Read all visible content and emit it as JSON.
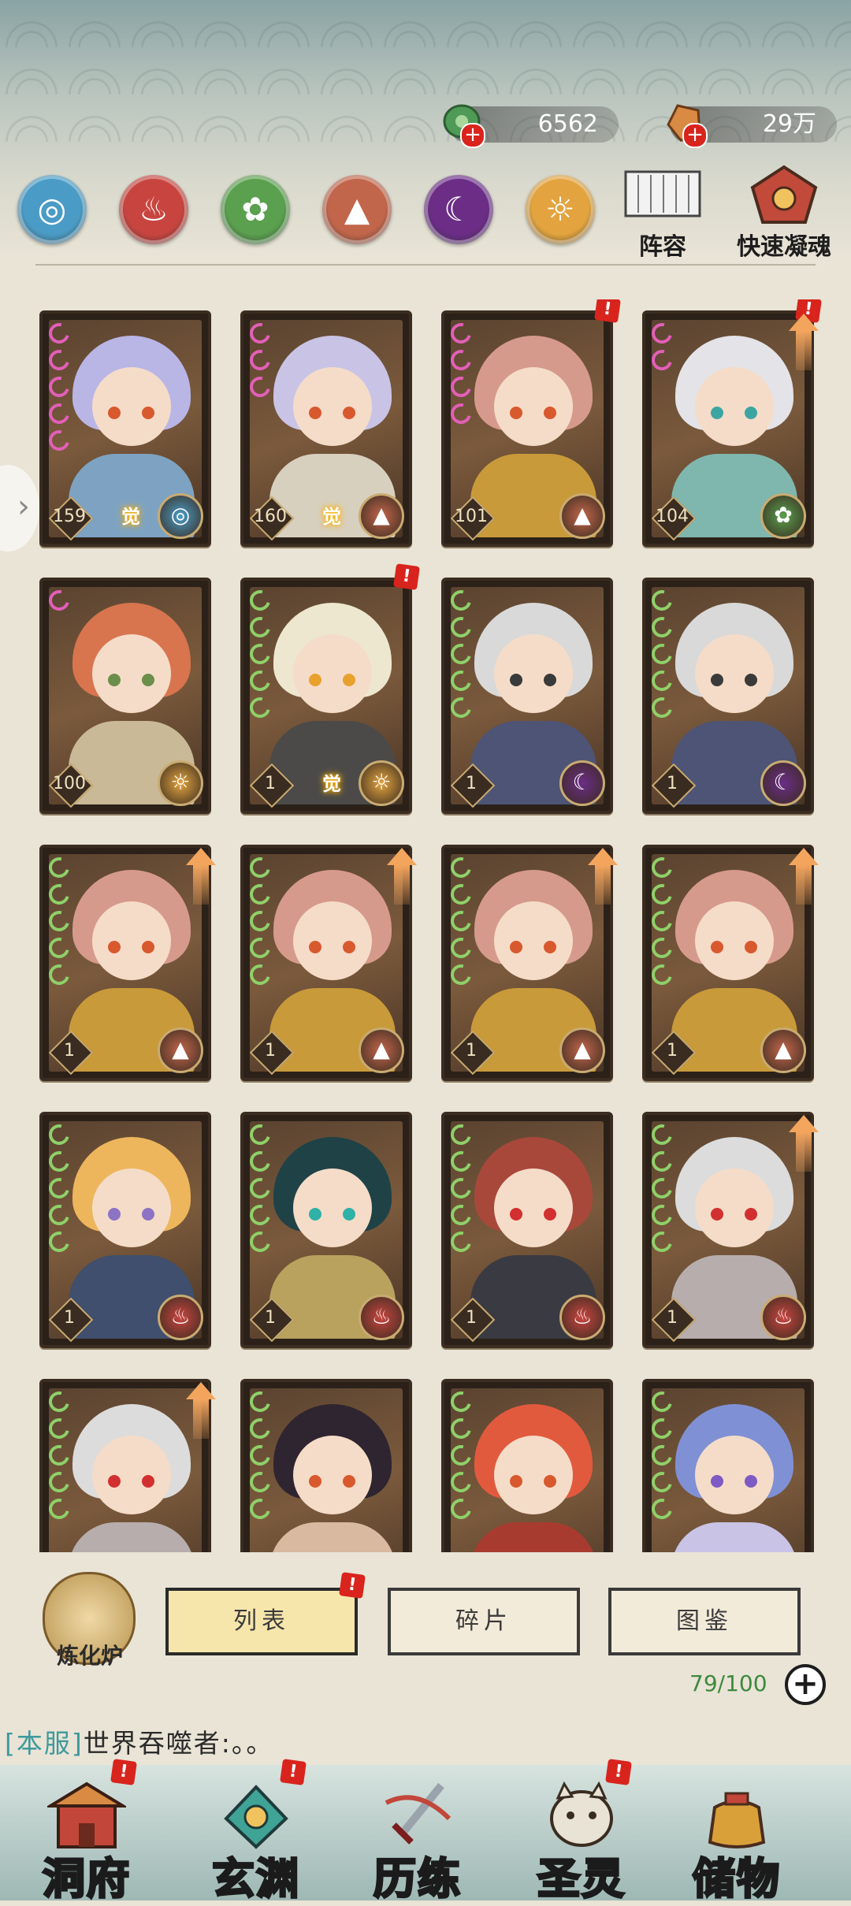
{
  "currency": {
    "jade_amount": "6562",
    "gold_amount": "29万",
    "plus": "+"
  },
  "elements": [
    {
      "name": "water",
      "color": "#4a9cc6",
      "glyph": "◎"
    },
    {
      "name": "fire",
      "color": "#c8453f",
      "glyph": "♨"
    },
    {
      "name": "wood",
      "color": "#5aa04e",
      "glyph": "✿"
    },
    {
      "name": "earth",
      "color": "#c2664b",
      "glyph": "▲"
    },
    {
      "name": "dark",
      "color": "#6b2d86",
      "glyph": "☾"
    },
    {
      "name": "light",
      "color": "#e3a43f",
      "glyph": "☼"
    }
  ],
  "top_buttons": {
    "lineup": "阵容",
    "quick_condense": "快速凝魂"
  },
  "cards": [
    {
      "level": "159",
      "pips": 5,
      "pip_color": "pink",
      "awaken": "觉",
      "element": "water",
      "alert": false,
      "up": false
    },
    {
      "level": "160",
      "pips": 3,
      "pip_color": "pink",
      "awaken": "觉",
      "element": "earth",
      "alert": false,
      "up": false
    },
    {
      "level": "101",
      "pips": 4,
      "pip_color": "pink",
      "awaken": "",
      "element": "earth",
      "alert": true,
      "up": false
    },
    {
      "level": "104",
      "pips": 2,
      "pip_color": "pink",
      "awaken": "",
      "element": "wood",
      "alert": true,
      "up": true
    },
    {
      "level": "100",
      "pips": 1,
      "pip_color": "pink",
      "awaken": "",
      "element": "light",
      "alert": false,
      "up": false
    },
    {
      "level": "1",
      "pips": 5,
      "pip_color": "green",
      "awaken": "觉",
      "element": "light",
      "alert": true,
      "up": false
    },
    {
      "level": "1",
      "pips": 5,
      "pip_color": "green",
      "awaken": "",
      "element": "dark",
      "alert": false,
      "up": false
    },
    {
      "level": "1",
      "pips": 5,
      "pip_color": "green",
      "awaken": "",
      "element": "dark",
      "alert": false,
      "up": false
    },
    {
      "level": "1",
      "pips": 5,
      "pip_color": "green",
      "awaken": "",
      "element": "earth",
      "alert": false,
      "up": true
    },
    {
      "level": "1",
      "pips": 5,
      "pip_color": "green",
      "awaken": "",
      "element": "earth",
      "alert": false,
      "up": true
    },
    {
      "level": "1",
      "pips": 5,
      "pip_color": "green",
      "awaken": "",
      "element": "earth",
      "alert": false,
      "up": true
    },
    {
      "level": "1",
      "pips": 5,
      "pip_color": "green",
      "awaken": "",
      "element": "earth",
      "alert": false,
      "up": true
    },
    {
      "level": "1",
      "pips": 5,
      "pip_color": "green",
      "awaken": "",
      "element": "fire",
      "alert": false,
      "up": false
    },
    {
      "level": "1",
      "pips": 5,
      "pip_color": "green",
      "awaken": "",
      "element": "fire",
      "alert": false,
      "up": false
    },
    {
      "level": "1",
      "pips": 5,
      "pip_color": "green",
      "awaken": "",
      "element": "fire",
      "alert": false,
      "up": false
    },
    {
      "level": "1",
      "pips": 5,
      "pip_color": "green",
      "awaken": "",
      "element": "fire",
      "alert": false,
      "up": true
    },
    {
      "level": "",
      "pips": 5,
      "pip_color": "green",
      "awaken": "",
      "element": "",
      "alert": false,
      "up": true
    },
    {
      "level": "",
      "pips": 5,
      "pip_color": "green",
      "awaken": "",
      "element": "",
      "alert": false,
      "up": false
    },
    {
      "level": "",
      "pips": 5,
      "pip_color": "green",
      "awaken": "",
      "element": "",
      "alert": false,
      "up": false
    },
    {
      "level": "",
      "pips": 5,
      "pip_color": "green",
      "awaken": "",
      "element": "",
      "alert": false,
      "up": false
    }
  ],
  "card_palettes": [
    {
      "hair": "#b9b6e6",
      "body": "#7ea3c2",
      "eye": "#d8592e"
    },
    {
      "hair": "#c9c4e6",
      "body": "#d8d0bf",
      "eye": "#d8592e"
    },
    {
      "hair": "#d69a8c",
      "body": "#c99a3a",
      "eye": "#d8592e"
    },
    {
      "hair": "#e3e3e8",
      "body": "#7fb7ae",
      "eye": "#3ca5a2"
    },
    {
      "hair": "#d8754e",
      "body": "#c9b996",
      "eye": "#6b8e4a"
    },
    {
      "hair": "#ede7cf",
      "body": "#4b4a48",
      "eye": "#e8a12d"
    },
    {
      "hair": "#d9d9d9",
      "body": "#4d5475",
      "eye": "#3a3a3a"
    },
    {
      "hair": "#d9d9d9",
      "body": "#4d5475",
      "eye": "#3a3a3a"
    },
    {
      "hair": "#d69a8c",
      "body": "#c99a3a",
      "eye": "#d8592e"
    },
    {
      "hair": "#d69a8c",
      "body": "#c99a3a",
      "eye": "#d8592e"
    },
    {
      "hair": "#d69a8c",
      "body": "#c99a3a",
      "eye": "#d8592e"
    },
    {
      "hair": "#d69a8c",
      "body": "#c99a3a",
      "eye": "#d8592e"
    },
    {
      "hair": "#eeb65c",
      "body": "#3f4f6d",
      "eye": "#8c73c4"
    },
    {
      "hair": "#1f4247",
      "body": "#b8a25e",
      "eye": "#2fb1a7"
    },
    {
      "hair": "#a8483b",
      "body": "#3a3a42",
      "eye": "#d23030"
    },
    {
      "hair": "#dcdcdc",
      "body": "#b8adad",
      "eye": "#d23030"
    },
    {
      "hair": "#dcdcdc",
      "body": "#b8adad",
      "eye": "#d23030"
    },
    {
      "hair": "#2f2530",
      "body": "#d9b9a0",
      "eye": "#d8592e"
    },
    {
      "hair": "#e25a3e",
      "body": "#a83b30",
      "eye": "#d8592e"
    },
    {
      "hair": "#7f91d4",
      "body": "#c9c4e6",
      "eye": "#7e5ac4"
    }
  ],
  "bottom": {
    "furnace_label": "炼化炉",
    "tab_list": "列表",
    "tab_fragments": "碎片",
    "tab_gallery": "图鉴",
    "count": "79/100",
    "add": "+",
    "chat_tag": "[本服]",
    "chat_text": "世界吞噬者:。。"
  },
  "nav": [
    {
      "label": "洞府",
      "alert": true
    },
    {
      "label": "玄渊",
      "alert": true
    },
    {
      "label": "历练",
      "alert": false
    },
    {
      "label": "圣灵",
      "alert": true
    },
    {
      "label": "储物",
      "alert": false
    }
  ],
  "colors": {
    "alert_red": "#d8241d",
    "count_green": "#3d8a3d",
    "chat_tag": "#3e9a9c"
  }
}
